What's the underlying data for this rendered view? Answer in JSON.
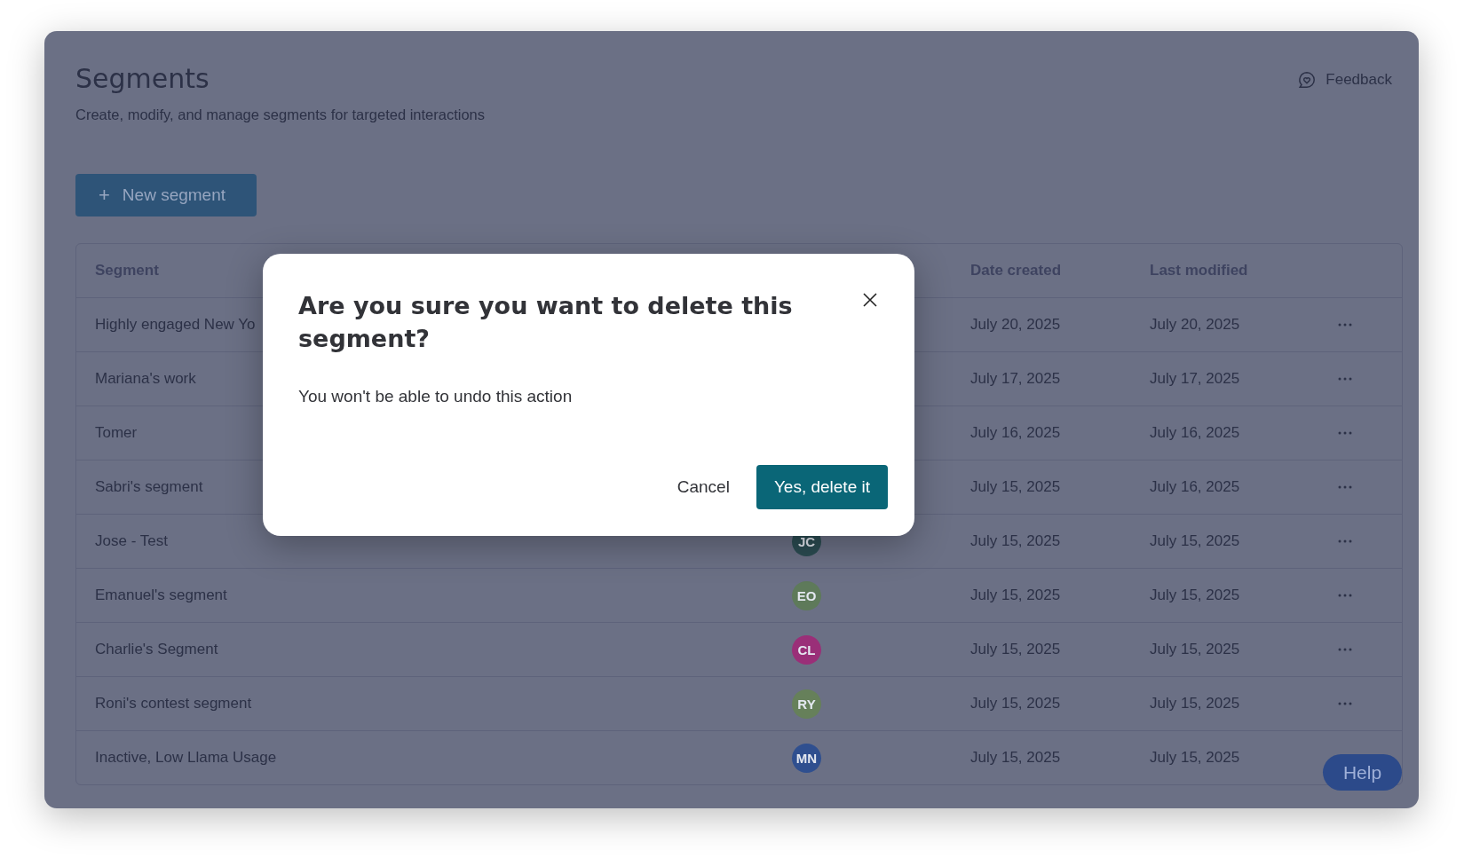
{
  "header": {
    "title": "Segments",
    "subtitle": "Create, modify, and manage segments for targeted interactions",
    "feedback": "Feedback"
  },
  "new_button": {
    "icon": "+",
    "label": "New segment"
  },
  "table": {
    "columns": [
      "Segment",
      "Date created",
      "Last modified"
    ],
    "rows": [
      {
        "segment": "Highly engaged New Yo",
        "created": "July 20, 2025",
        "modified": "July 20, 2025"
      },
      {
        "segment": "Mariana's work",
        "created": "July 17, 2025",
        "modified": "July 17, 2025"
      },
      {
        "segment": "Tomer",
        "created": "July 16, 2025",
        "modified": "July 16, 2025"
      },
      {
        "segment": "Sabri's segment",
        "created": "July 15, 2025",
        "modified": "July 16, 2025"
      },
      {
        "segment": "Jose - Test",
        "owner": {
          "initials": "JC",
          "color": "#2b4c52"
        },
        "created": "July 15, 2025",
        "modified": "July 15, 2025"
      },
      {
        "segment": "Emanuel's segment",
        "owner": {
          "initials": "EO",
          "color": "#5e7a5a"
        },
        "created": "July 15, 2025",
        "modified": "July 15, 2025"
      },
      {
        "segment": "Charlie's Segment",
        "owner": {
          "initials": "CL",
          "color": "#9a2f78"
        },
        "created": "July 15, 2025",
        "modified": "July 15, 2025"
      },
      {
        "segment": "Roni's contest segment",
        "owner": {
          "initials": "RY",
          "color": "#66805a"
        },
        "created": "July 15, 2025",
        "modified": "July 15, 2025"
      },
      {
        "segment": "Inactive, Low Llama Usage",
        "owner": {
          "initials": "MN",
          "color": "#2f4f8f"
        },
        "created": "July 15, 2025",
        "modified": "July 15, 2025"
      }
    ]
  },
  "help_button": "Help",
  "dialog": {
    "title": "Are you sure you want to delete this segment?",
    "message": "You won't be able to undo this action",
    "cancel": "Cancel",
    "confirm": "Yes, delete it"
  }
}
